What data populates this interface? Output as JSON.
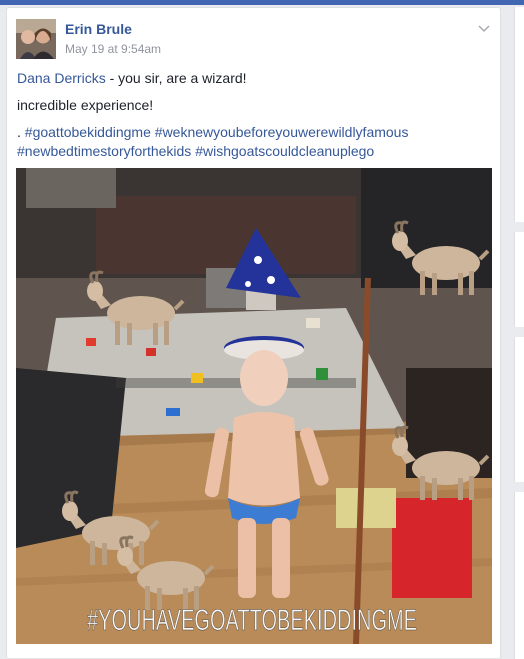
{
  "post": {
    "author": "Erin Brule",
    "timestamp": "May 19 at 9:54am",
    "mention": "Dana Derricks",
    "line1_rest": " - you sir, are a wizard!",
    "line2": "incredible experience!",
    "tag_prefix": ". ",
    "hashtags_line1": [
      "#goattobekiddingme",
      "#weknewyoubeforeyouwerewildlyfamous"
    ],
    "hashtags_line2": [
      "#newbedtimestoryforthekids",
      "#wishgoatscouldcleanuplego"
    ],
    "photo_overlay_text": "#YOUHAVEGOATTOBEKIDDINGME"
  },
  "icons": {
    "options": "chevron-down-icon",
    "avatar": "profile-photo"
  },
  "colors": {
    "link": "#365899",
    "text": "#1d2129",
    "meta": "#90949c",
    "topbar": "#4267b2",
    "page_bg": "#e9ebee"
  }
}
